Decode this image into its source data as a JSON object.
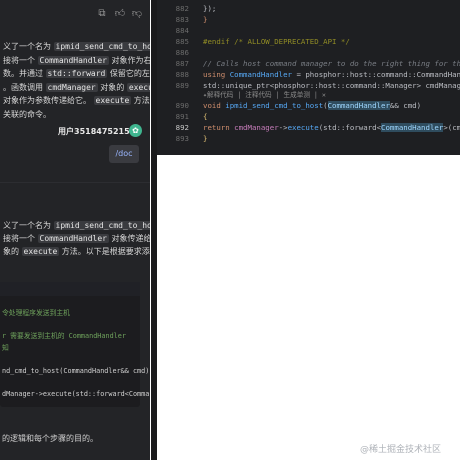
{
  "chat": {
    "lines": [
      {
        "parts": [
          {
            "t": "义了一个名为 "
          },
          {
            "t": "ipmid_send_cmd_to_host",
            "code": true
          }
        ]
      },
      {
        "parts": [
          {
            "t": "接将一个 "
          },
          {
            "t": "CommandHandler",
            "code": true
          },
          {
            "t": " 对象作为右值"
          }
        ]
      },
      {
        "parts": [
          {
            "t": "数。并通过 "
          },
          {
            "t": "std::forward",
            "code": true
          },
          {
            "t": " 保留它的左值"
          }
        ]
      },
      {
        "parts": [
          {
            "t": "。函数调用 "
          },
          {
            "t": "cmdManager",
            "code": true
          },
          {
            "t": " 对象的 "
          },
          {
            "t": "execut",
            "code": true
          }
        ]
      },
      {
        "parts": [
          {
            "t": "对象作为参数传递给它。 "
          },
          {
            "t": "execute",
            "code": true
          },
          {
            "t": " 方法执"
          }
        ]
      },
      {
        "parts": [
          {
            "t": "关联的命令。"
          }
        ]
      }
    ],
    "user_name": "用户35184752150",
    "avatar_glyph": "✿",
    "user_message": "/doc",
    "lines2": [
      {
        "parts": [
          {
            "t": "义了一个名为 "
          },
          {
            "t": "ipmid_send_cmd_to_hos",
            "code": true
          }
        ]
      },
      {
        "parts": [
          {
            "t": "接将一个 "
          },
          {
            "t": "CommandHandler",
            "code": true
          },
          {
            "t": " 对象传递给"
          }
        ]
      },
      {
        "parts": [
          {
            "t": "象的 "
          },
          {
            "t": "execute",
            "code": true
          },
          {
            "t": " 方法。以下是根据要求添"
          }
        ]
      }
    ],
    "answer_code": [
      {
        "text": "令处理程序发送到主机",
        "cls": "cmt"
      },
      {
        "text": "",
        "cls": ""
      },
      {
        "text": "r 需要发送到主机的 CommandHandler",
        "cls": "cmt"
      },
      {
        "text": "知",
        "cls": "cmt"
      },
      {
        "text": "",
        "cls": ""
      },
      {
        "text": "nd_cmd_to_host(CommandHandler&& cmd)",
        "cls": "ans-text"
      },
      {
        "text": "",
        "cls": ""
      },
      {
        "text": "dManager->execute(std::forward<Comman",
        "cls": "ans-text"
      }
    ],
    "footer_text": "的逻辑和每个步骤的目的。"
  },
  "editor": {
    "lines": [
      {
        "num": "882",
        "html_id": "l882"
      },
      {
        "num": "883",
        "html_id": "l883"
      },
      {
        "num": "884",
        "html_id": "l884"
      },
      {
        "num": "885",
        "html_id": "l885"
      },
      {
        "num": "886",
        "html_id": "l886"
      },
      {
        "num": "887",
        "html_id": "l887"
      },
      {
        "num": "888",
        "html_id": "l888"
      },
      {
        "num": "889",
        "html_id": "l889"
      },
      {
        "num": "",
        "html_id": "lens"
      },
      {
        "num": "890",
        "html_id": "l890"
      },
      {
        "num": "891",
        "html_id": "l891"
      },
      {
        "num": "892",
        "html_id": "l892"
      },
      {
        "num": "893",
        "html_id": "l893"
      }
    ],
    "code": {
      "l882": "    });",
      "l883": "}",
      "l885": "#endif /* ALLOW_DEPRECATED_API */",
      "l887": "// Calls host command manager to do the right thing for th",
      "l888a": "using ",
      "l888b": "CommandHandler",
      "l888c": " = phosphor::host::command::CommandHan",
      "l889a": "std::unique_ptr<phosphor::host::command::Manager> cmdManag",
      "lens": "✦解释代码 | 注释代码 | 生成单测 | ✕",
      "l890a": "void ",
      "l890b": "ipmid_send_cmd_to_host",
      "l890c": "(",
      "l890d": "CommandHandler",
      "l890e": "&& cmd)",
      "l891": "{",
      "l892a": "    return ",
      "l892b": "cmdManager",
      "l892c": "->",
      "l892d": "execute",
      "l892e": "(std::forward<",
      "l892f": "CommandHandler",
      "l892g": ">(cmd))",
      "l893": "}"
    }
  },
  "watermark": "@稀土掘金技术社区"
}
